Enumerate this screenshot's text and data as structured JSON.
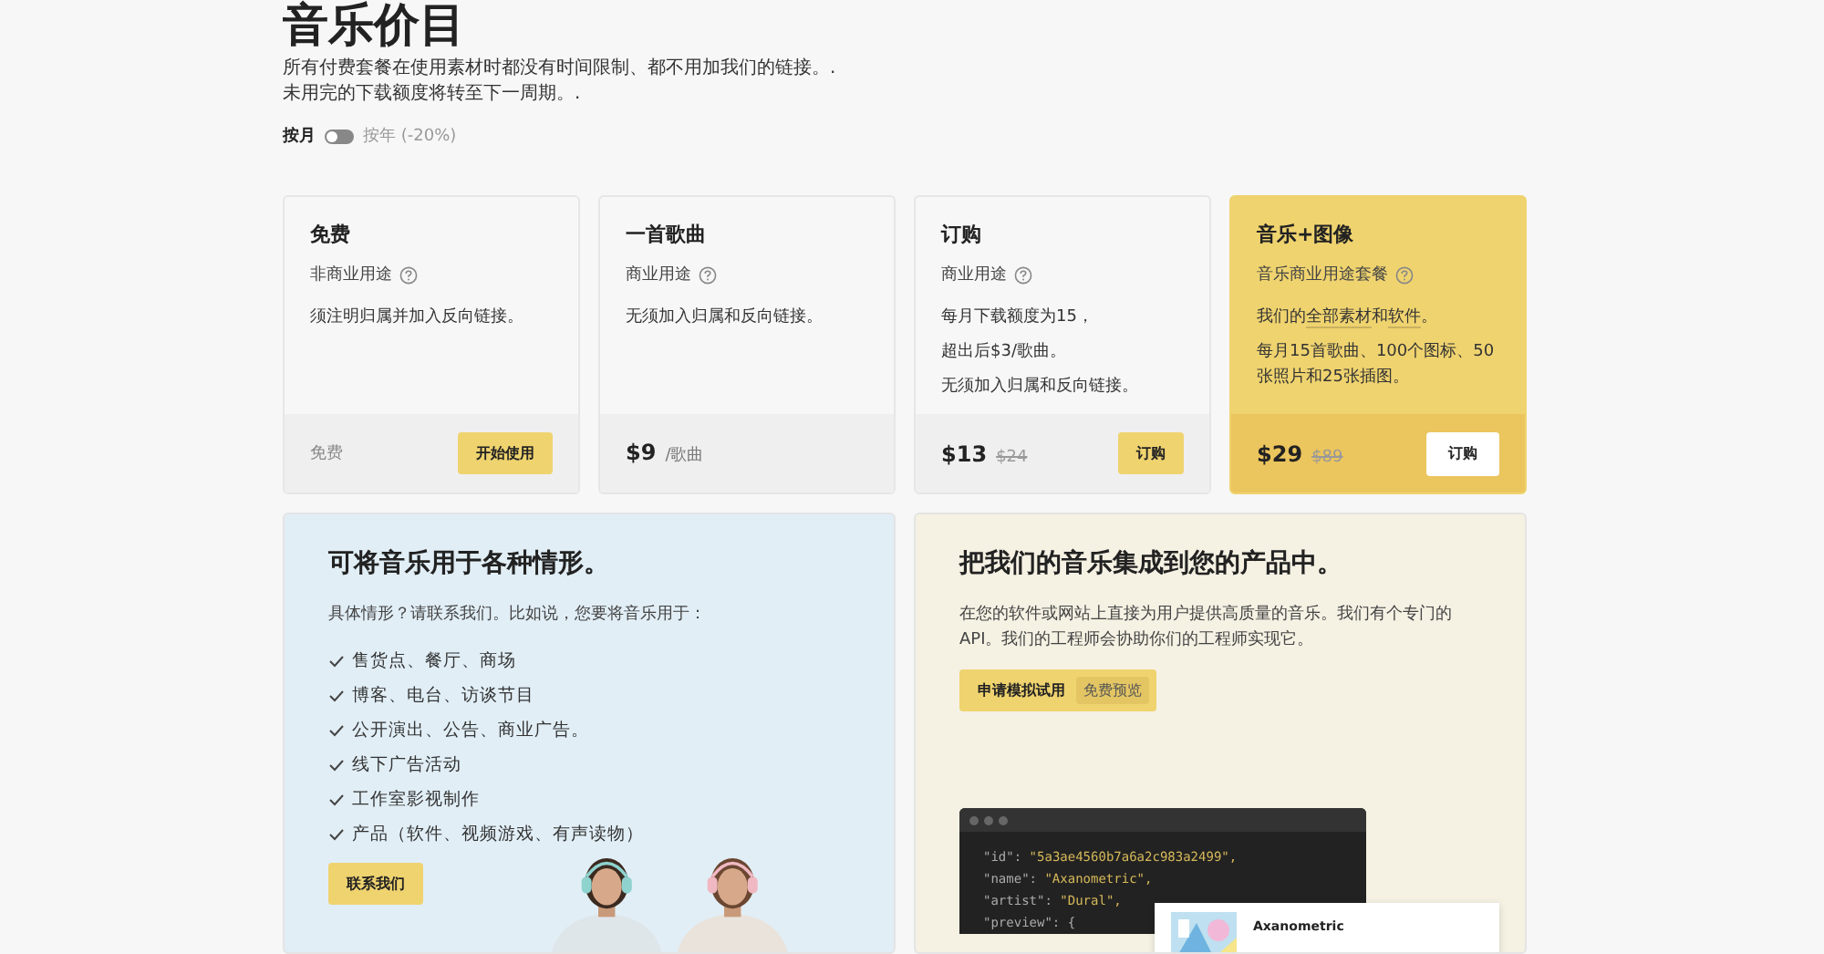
{
  "title": "音乐价目",
  "subtitle_lines": [
    "所有付费套餐在使用素材时都没有时间限制、都不用加我们的链接。.",
    "未用完的下载额度将转至下一周期。."
  ],
  "billing": {
    "monthly_label": "按月",
    "yearly_label": "按年 (-20%)",
    "yearly": false
  },
  "plans": [
    {
      "kind": "free",
      "name": "免费",
      "usage": "非商业用途",
      "featured": false,
      "desc": [
        [
          {
            "text": "须注明归属并加入反向链接。"
          }
        ]
      ],
      "price": "免费",
      "button": "开始使用"
    },
    {
      "kind": "paid",
      "name": "一首歌曲",
      "usage": "商业用途",
      "featured": false,
      "desc": [
        [
          {
            "text": "无须加入归属和反向链接。"
          }
        ]
      ],
      "price": "$9",
      "unit": "/歌曲"
    },
    {
      "kind": "paid",
      "name": "订购",
      "usage": "商业用途",
      "featured": false,
      "desc": [
        [
          {
            "text": "每月下载额度为15，"
          }
        ],
        [
          {
            "text": "超出后$3/歌曲。"
          }
        ],
        [
          {
            "text": "无须加入归属和反向链接。"
          }
        ]
      ],
      "price": "$13",
      "old_price": "$24",
      "button": "订购"
    },
    {
      "kind": "paid",
      "name": "音乐+图像",
      "usage": "音乐商业用途套餐",
      "featured": true,
      "desc": [
        [
          {
            "text": "我们的"
          },
          {
            "text": "全部素材",
            "link": true
          },
          {
            "text": "和"
          },
          {
            "text": "软件",
            "link": true
          },
          {
            "text": "。"
          }
        ],
        [
          {
            "text": "每月15首歌曲、100个图标、50张照片和25张插图。"
          }
        ]
      ],
      "price": "$29",
      "old_price": "$89",
      "button": "订购"
    }
  ],
  "uses": {
    "title": "可将音乐用于各种情形。",
    "intro": "具体情形？请联系我们。比如说，您要将音乐用于：",
    "items": [
      "售货点、餐厅、商场",
      "博客、电台、访谈节目",
      "公开演出、公告、商业广告。",
      "线下广告活动",
      "工作室影视制作",
      "产品（软件、视频游戏、有声读物）"
    ],
    "button": "联系我们"
  },
  "api": {
    "title": "把我们的音乐集成到您的产品中。",
    "text": "在您的软件或网站上直接为用户提供高质量的音乐。我们有个专门的API。我们的工程师会协助你们的工程师实现它。",
    "button": "申请模拟试用",
    "button_badge": "免费预览",
    "code": [
      {
        "key": "\"id\": ",
        "value": "\"5a3ae4560b7a6a2c983a2499\","
      },
      {
        "key": "\"name\": ",
        "value": "\"Axanometric\","
      },
      {
        "key": "\"artist\": ",
        "value": "\"Dural\","
      },
      {
        "key": "\"preview\": {"
      }
    ],
    "track": {
      "title": "Axanometric"
    }
  }
}
